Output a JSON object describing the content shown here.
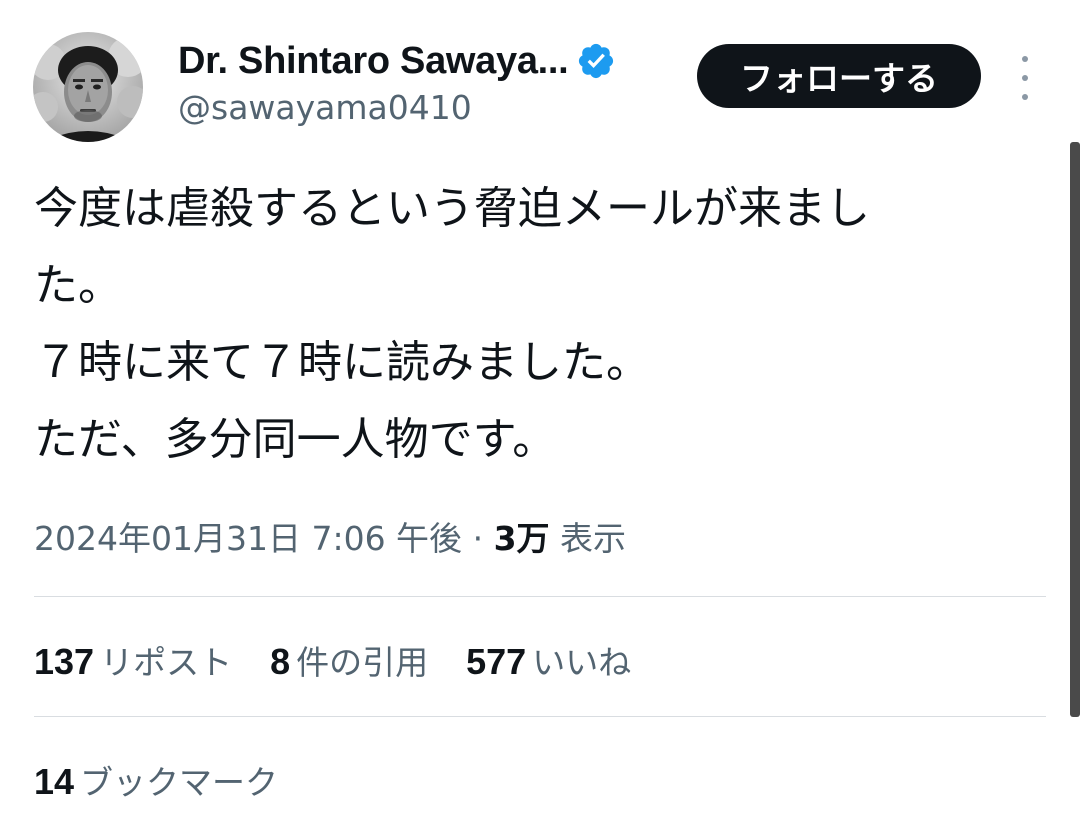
{
  "author": {
    "display_name": "Dr. Shintaro Sawaya...",
    "handle": "@sawayama0410",
    "verified_icon": "verified-badge-icon",
    "avatar_icon": "profile-photo"
  },
  "header": {
    "follow_label": "フォローする",
    "more_icon": "more-vertical-icon"
  },
  "tweet": {
    "lines": [
      "今度は虐殺するという脅迫メールが来まし",
      "た。",
      "７時に来て７時に読みました。",
      "ただ、多分同一人物です。"
    ]
  },
  "meta": {
    "date": "2024年01月31日 7:06 午後",
    "separator": "·",
    "views_count": "3万",
    "views_label": "表示"
  },
  "stats": {
    "reposts_count": "137",
    "reposts_label": "リポスト",
    "quotes_count": "8",
    "quotes_label": "件の引用",
    "likes_count": "577",
    "likes_label": "いいね"
  },
  "bookmarks": {
    "count": "14",
    "label": "ブックマーク"
  },
  "colors": {
    "text_primary": "#0f1419",
    "text_secondary": "#536471",
    "verified_blue": "#1d9bf0",
    "button_bg": "#0f1419",
    "divider": "#d9dde1"
  }
}
